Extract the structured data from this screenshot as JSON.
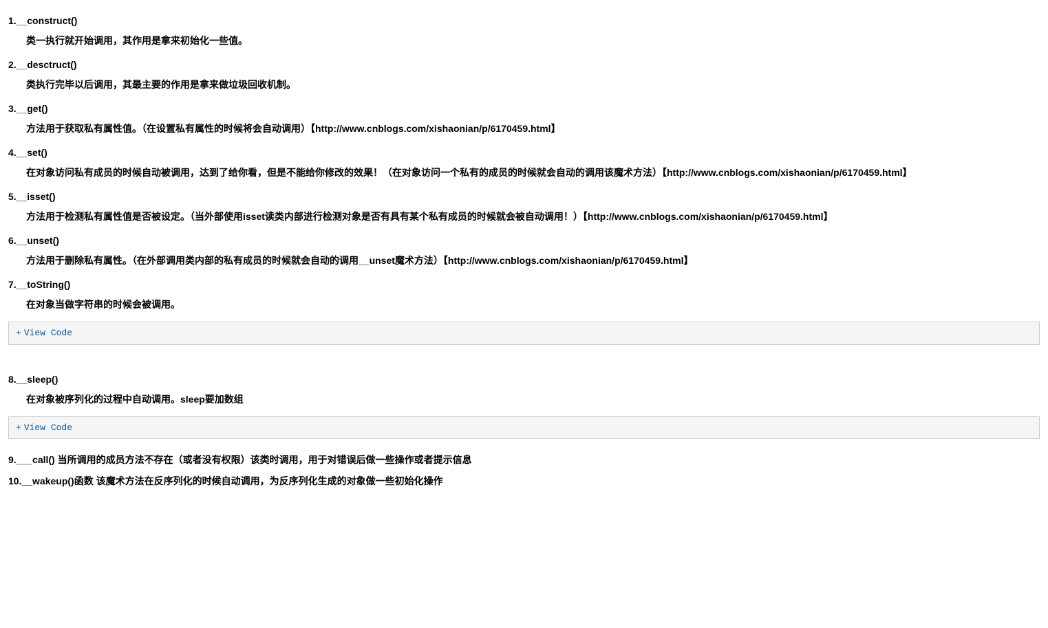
{
  "items": [
    {
      "title": "1.__construct()",
      "desc": "类一执行就开始调用，其作用是拿来初始化一些值。"
    },
    {
      "title": "2.__desctruct()",
      "desc": "类执行完毕以后调用，其最主要的作用是拿来做垃圾回收机制。"
    },
    {
      "title": "3.__get()",
      "desc": "方法用于获取私有属性值。（在设置私有属性的时候将会自动调用）【http://www.cnblogs.com/xishaonian/p/6170459.html】"
    },
    {
      "title": "4.__set()",
      "desc": "在对象访问私有成员的时候自动被调用，达到了给你看，但是不能给你修改的效果！（在对象访问一个私有的成员的时候就会自动的调用该魔术方法）【http://www.cnblogs.com/xishaonian/p/6170459.html】"
    },
    {
      "title": "5.__isset()",
      "desc": "方法用于检测私有属性值是否被设定。（当外部使用isset读类内部进行检测对象是否有具有某个私有成员的时候就会被自动调用！）【http://www.cnblogs.com/xishaonian/p/6170459.html】"
    },
    {
      "title": "6.__unset()",
      "desc": "方法用于删除私有属性。（在外部调用类内部的私有成员的时候就会自动的调用__unset魔术方法）【http://www.cnblogs.com/xishaonian/p/6170459.html】"
    },
    {
      "title": "7.__toString()",
      "desc": "在对象当做字符串的时候会被调用。"
    }
  ],
  "viewcode1": {
    "plus": "+",
    "label": "View Code"
  },
  "item8": {
    "title": "8.__sleep()",
    "desc": "在对象被序列化的过程中自动调用。sleep要加数组"
  },
  "viewcode2": {
    "plus": "+",
    "label": "View Code"
  },
  "item9": {
    "title": "9.___call() 当所调用的成员方法不存在（或者没有权限）该类时调用，用于对错误后做一些操作或者提示信息"
  },
  "item10": {
    "title": "10.__wakeup()函数 该魔术方法在反序列化的时候自动调用，为反序列化生成的对象做一些初始化操作"
  }
}
